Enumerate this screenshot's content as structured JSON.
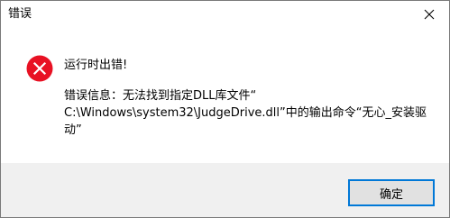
{
  "window": {
    "title": "错误",
    "close_icon": "close-icon"
  },
  "content": {
    "icon": "error-icon",
    "icon_color": "#e81123",
    "heading": "运行时出错!",
    "message_lines": [
      "错误信息：无法找到指定DLL库文件“",
      "C:\\Windows\\system32\\JudgeDrive.dll”中的输出命令“无心_安装驱",
      "动”"
    ]
  },
  "footer": {
    "ok_label": "确定",
    "accent_color": "#0078d7"
  }
}
